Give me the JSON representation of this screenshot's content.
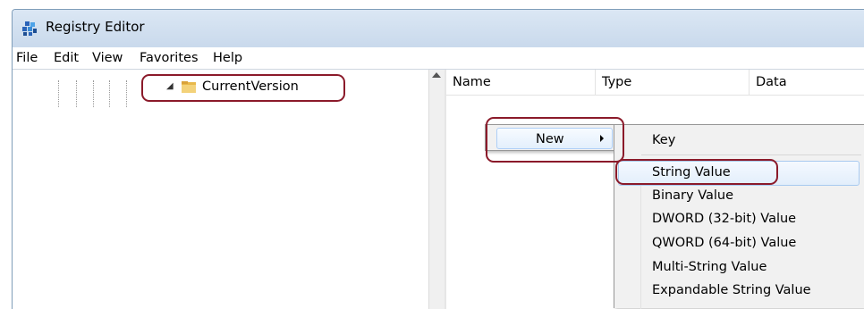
{
  "window": {
    "title": "Registry Editor"
  },
  "menu": [
    "File",
    "Edit",
    "View",
    "Favorites",
    "Help"
  ],
  "tree": {
    "selected_key": "CurrentVersion"
  },
  "columns": [
    "Name",
    "Type",
    "Data"
  ],
  "context_menu": {
    "new_label": "New"
  },
  "submenu": {
    "items": [
      "Key",
      "String Value",
      "Binary Value",
      "DWORD (32-bit) Value",
      "QWORD (64-bit) Value",
      "Multi-String Value",
      "Expandable String Value"
    ],
    "highlighted": "String Value"
  },
  "colors": {
    "annotation": "#8b1a2a",
    "highlight_border": "#a8caf0"
  }
}
